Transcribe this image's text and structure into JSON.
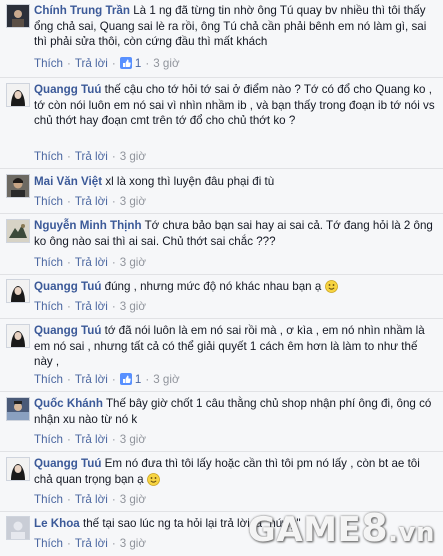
{
  "comments": [
    {
      "author": "Chính Trung Trần",
      "text": "Là 1 ng đã từng tin nhờ ông Tú quay bv nhiều thì tôi thấy ổng chả sai, Quang sai lè ra rồi, ông Tú chả cần phải bênh em nó làm gì, sai thì phải sửa thôi, còn cứng đầu thì mất khách",
      "like": "Thích",
      "reply": "Trả lời",
      "likes": "1",
      "time": "3 giờ"
    },
    {
      "author": "Quangg Tuú",
      "text": "thế cậu cho tớ hỏi tớ sai ở điểm nào ? Tớ có đổ cho Quang ko , tớ còn nói luôn em nó sai vì nhìn nhầm ib , và bạn thấy trong đoạn ib tớ nói vs chủ thớt hay đoạn cmt trên tớ đổ cho chủ thớt ko ?",
      "like": "Thích",
      "reply": "Trả lời",
      "time": "3 giờ"
    },
    {
      "author": "Mai Văn Việt",
      "text": "xl là xong thì luyện đâu phại đi tù",
      "like": "Thích",
      "reply": "Trả lời",
      "time": "3 giờ"
    },
    {
      "author": "Nguyễn Minh Thịnh",
      "text": "Tớ chưa bảo bạn sai hay ai sai cả. Tớ đang hỏi là 2 ông ko ông nào sai thì ai sai. Chủ thớt sai chắc ???",
      "like": "Thích",
      "reply": "Trả lời",
      "time": "3 giờ"
    },
    {
      "author": "Quangg Tuú",
      "text": "đúng , nhưng mức độ nó khác nhau bạn ạ",
      "like": "Thích",
      "reply": "Trả lời",
      "time": "3 giờ"
    },
    {
      "author": "Quangg Tuú",
      "text": "tớ đã nói luôn là em nó sai rồi mà , ơ kìa , em nó nhìn nhầm là em nó sai , nhưng tất cả có thể giải quyết 1 cách êm hơn là làm to như thế này ,",
      "like": "Thích",
      "reply": "Trả lời",
      "likes": "1",
      "time": "3 giờ"
    },
    {
      "author": "Quốc Khánh",
      "text": "Thế bây giờ chốt 1 câu thằng chủ shop nhận phí ông đi, ông có nhận xu nào từ nó k",
      "like": "Thích",
      "reply": "Trả lời",
      "time": "3 giờ"
    },
    {
      "author": "Quangg Tuú",
      "text": "Em nó đưa thì tôi lấy hoặc cần thì tôi pm nó lấy , còn bt ae tôi chả quan trọng bạn ạ",
      "like": "Thích",
      "reply": "Trả lời",
      "time": "3 giờ"
    },
    {
      "author": "Le Khoa",
      "text": "thế tại sao lúc ng ta hỏi lại trả lời là \"hứng\"",
      "like": "Thích",
      "reply": "Trả lời",
      "time": "3 giờ"
    }
  ],
  "watermark": {
    "game": "GAME",
    "eight": "8",
    "vn": ".vn"
  },
  "colors": {
    "author": "#3b5998",
    "link": "#4b67a1",
    "meta": "#90949c",
    "background": "#f6f7f9"
  }
}
